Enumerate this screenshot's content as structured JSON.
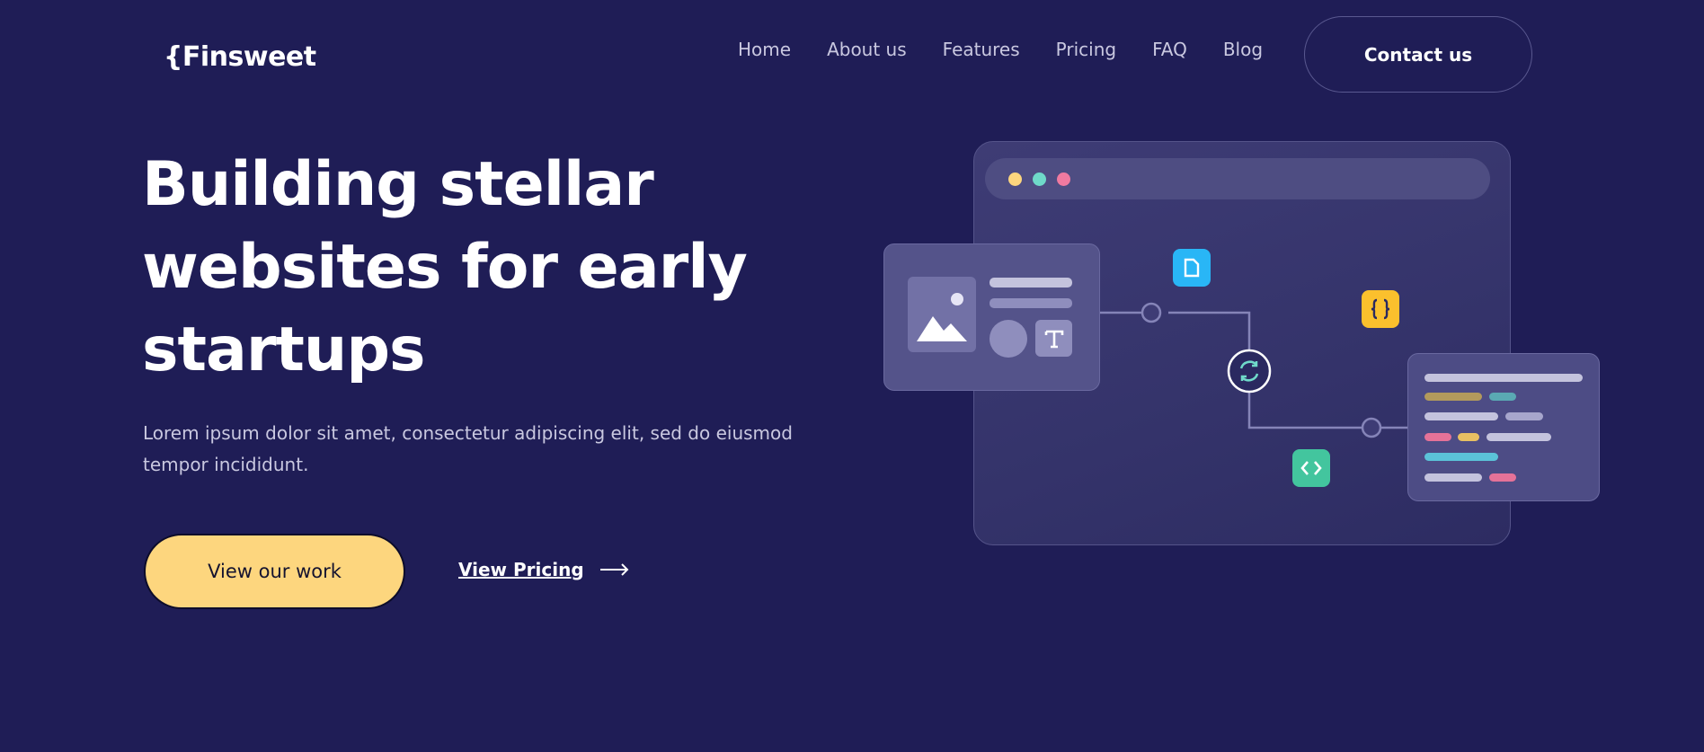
{
  "brand": {
    "logo_text": "{Finsweet"
  },
  "nav": {
    "items": [
      {
        "label": "Home"
      },
      {
        "label": "About us"
      },
      {
        "label": "Features"
      },
      {
        "label": "Pricing"
      },
      {
        "label": "FAQ"
      },
      {
        "label": "Blog"
      }
    ],
    "contact_label": "Contact us"
  },
  "hero": {
    "title": "Building stellar websites for early startups",
    "description": "Lorem ipsum dolor sit amet, consectetur adipiscing elit, sed do eiusmod tempor incididunt.",
    "primary_button": "View our work",
    "secondary_link": "View Pricing"
  },
  "illustration": {
    "window_dots": [
      "#fdd67e",
      "#6fd9c9",
      "#f07aa0"
    ],
    "tags": [
      {
        "icon": "document-icon",
        "color": "#29b6f6"
      },
      {
        "icon": "curly-braces-icon",
        "text": "{ }",
        "color": "#fbc02d"
      },
      {
        "icon": "code-brackets-icon",
        "color": "#43c59e"
      }
    ]
  },
  "colors": {
    "background": "#1f1d56",
    "accent": "#fdd67e",
    "muted_text": "#c9c8e0"
  }
}
